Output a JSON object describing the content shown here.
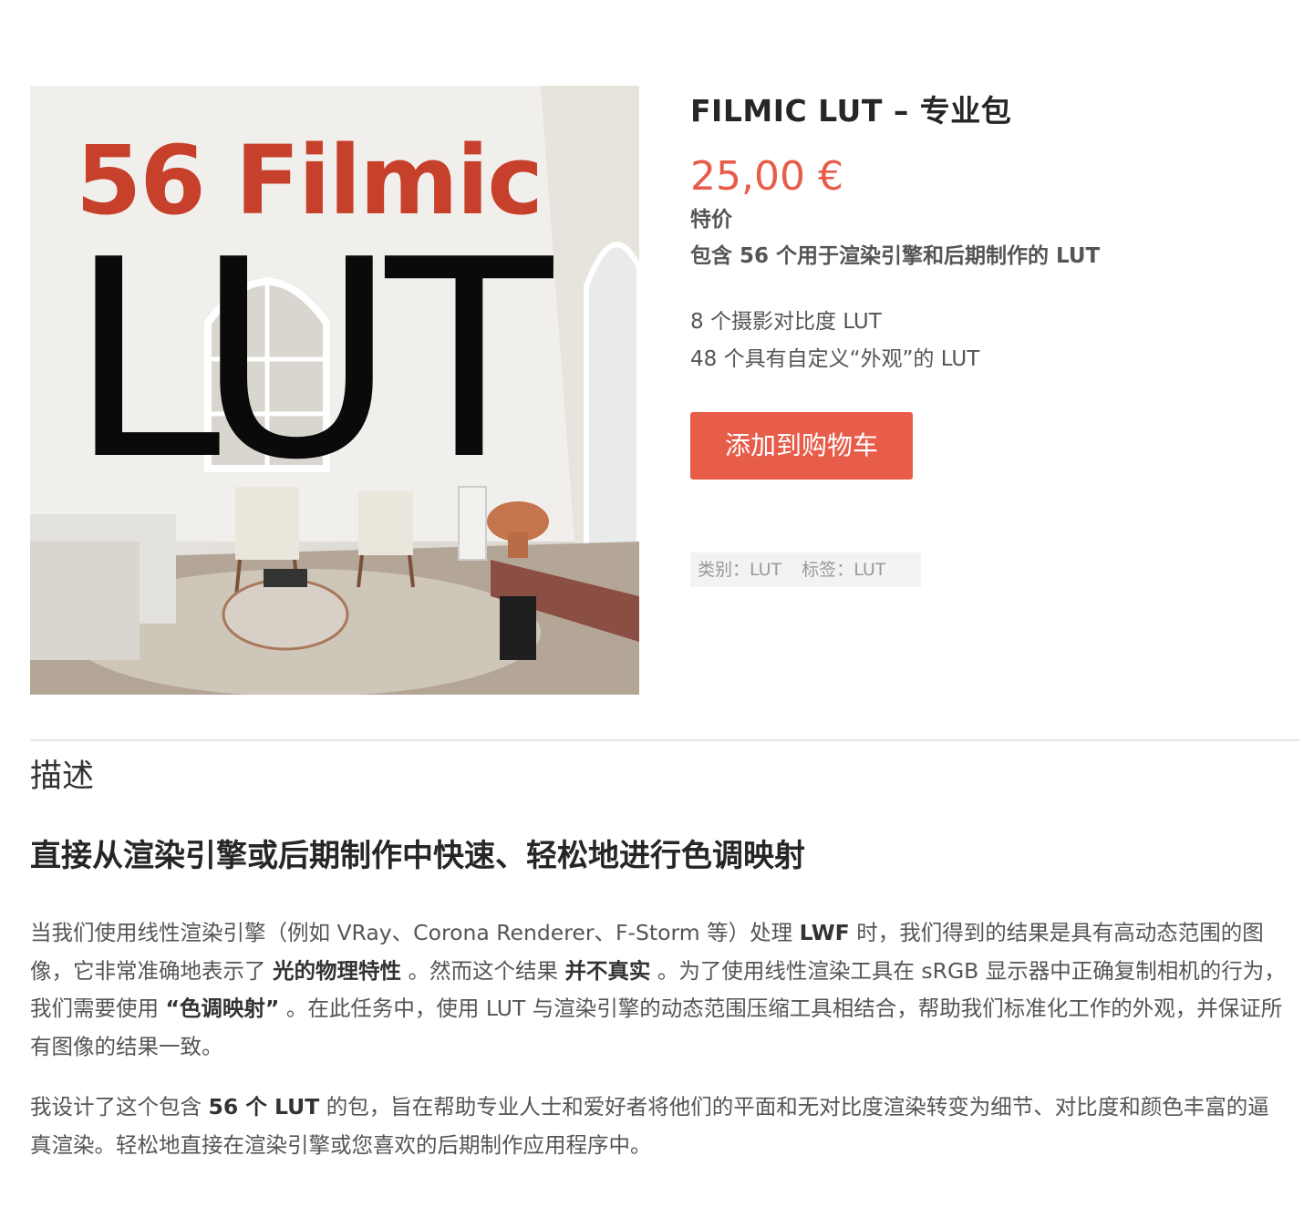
{
  "product": {
    "image": {
      "text_line1": "56 Filmic",
      "text_line2": "LUT"
    },
    "title": "FILMIC LUT – 专业包",
    "price": "25,00",
    "currency": "€",
    "sale_label": "特价",
    "subtitle": "包含 56 个用于渲染引擎和后期制作的 LUT",
    "features": [
      "8 个摄影对比度 LUT",
      "48 个具有自定义“外观”的 LUT"
    ],
    "add_to_cart_label": "添加到购物车",
    "meta": {
      "category_label": "类别：",
      "category_value": "LUT",
      "tag_label": "标签：",
      "tag_value": "LUT"
    }
  },
  "description": {
    "tab_title": "描述",
    "heading": "直接从渲染引擎或后期制作中快速、轻松地进行色调映射",
    "paragraph1": {
      "t1": "当我们使用线性渲染引擎（例如 VRay、Corona Renderer、F-Storm 等）处理 ",
      "b1": "LWF",
      "t2": " 时，我们得到的结果是具有高动态范围的图像，它非常准确地表示了 ",
      "b2": "光的物理特性",
      "t3": " 。然而这个结果 ",
      "b3": "并不真实",
      "t4": " 。为了使用线性渲染工具在 sRGB 显示器中正确复制相机的行为，我们需要使用 ",
      "b4": "“色调映射”",
      "t5": " 。在此任务中，使用 LUT 与渲染引擎的动态范围压缩工具相结合，帮助我们标准化工作的外观，并保证所有图像的结果一致。"
    },
    "paragraph2": {
      "t1": "我设计了这个包含 ",
      "b1": "56 个 LUT",
      "t2": " 的包，旨在帮助专业人士和爱好者将他们的平面和无对比度渲染转变为细节、对比度和颜色丰富的逼真渲染。轻松地直接在渲染引擎或您喜欢的后期制作应用程序中。"
    }
  },
  "colors": {
    "accent": "#e85c4a",
    "image_text_red": "#c6402b",
    "body_text": "#555555",
    "heading_text": "#262626"
  }
}
